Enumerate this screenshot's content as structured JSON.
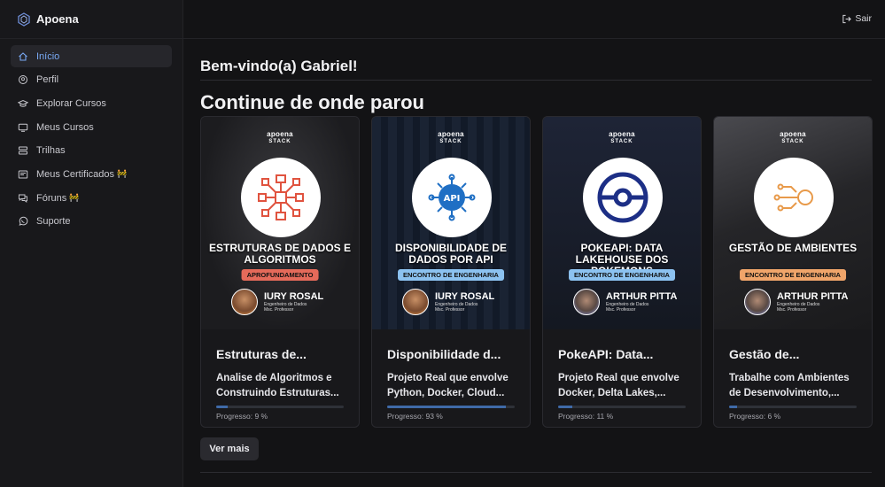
{
  "brand": {
    "name": "Apoena"
  },
  "topbar": {
    "logout_label": "Sair"
  },
  "sidebar": {
    "items": [
      {
        "label": "Início",
        "icon": "home-icon",
        "active": true
      },
      {
        "label": "Perfil",
        "icon": "user-circle-icon"
      },
      {
        "label": "Explorar Cursos",
        "icon": "graduation-cap-icon"
      },
      {
        "label": "Meus Cursos",
        "icon": "monitor-icon"
      },
      {
        "label": "Trilhas",
        "icon": "layers-icon"
      },
      {
        "label": "Meus Certificados",
        "icon": "certificate-icon",
        "badge": "🚧"
      },
      {
        "label": "Fóruns",
        "icon": "chat-icon",
        "badge": "🚧"
      },
      {
        "label": "Suporte",
        "icon": "whatsapp-icon"
      }
    ]
  },
  "main": {
    "welcome": "Bem-vindo(a) Gabriel!",
    "section_title": "Continue de onde parou",
    "more_label": "Ver mais",
    "cards": [
      {
        "thumb": {
          "brand": "apoena",
          "brand_sub": "STACK",
          "title": "Estruturas de dados e algoritmos",
          "tag": "APROFUNDAMENTO",
          "speaker": "IURY ROSAL",
          "role1": "Engenheiro de Dados",
          "role2": "Msc. Professor"
        },
        "title": "Estruturas de...",
        "description": "Analise de Algoritmos e Construindo Estruturas...",
        "progress_label": "Progresso: 9 %",
        "progress": 9
      },
      {
        "thumb": {
          "brand": "apoena",
          "brand_sub": "STACK",
          "title": "Disponibilidade de dados por API",
          "tag": "ENCONTRO DE ENGENHARIA",
          "speaker": "IURY ROSAL",
          "role1": "Engenheiro de Dados",
          "role2": "Msc. Professor"
        },
        "title": "Disponibilidade d...",
        "description": "Projeto Real que envolve Python, Docker, Cloud...",
        "progress_label": "Progresso: 93 %",
        "progress": 93
      },
      {
        "thumb": {
          "brand": "apoena",
          "brand_sub": "STACK",
          "title": "PokeAPI: Data Lakehouse dos Pokemons",
          "tag": "ENCONTRO DE ENGENHARIA",
          "speaker": "ARTHUR PITTA",
          "role1": "Engenheiro de Dados",
          "role2": "Msc. Professor"
        },
        "title": "PokeAPI: Data...",
        "description": "Projeto Real que envolve Docker, Delta Lakes,...",
        "progress_label": "Progresso: 11 %",
        "progress": 11
      },
      {
        "thumb": {
          "brand": "apoena",
          "brand_sub": "STACK",
          "title": "Gestão de Ambientes",
          "tag": "ENCONTRO DE ENGENHARIA",
          "speaker": "ARTHUR PITTA",
          "role1": "Engenheiro de Dados",
          "role2": "Msc. Professor"
        },
        "title": "Gestão de...",
        "description": "Trabalhe com Ambientes de Desenvolvimento,...",
        "progress_label": "Progresso: 6 %",
        "progress": 6
      }
    ]
  },
  "colors": {
    "accent": "#79aaf5",
    "progress": "#3f6aa8",
    "background": "#131315"
  }
}
